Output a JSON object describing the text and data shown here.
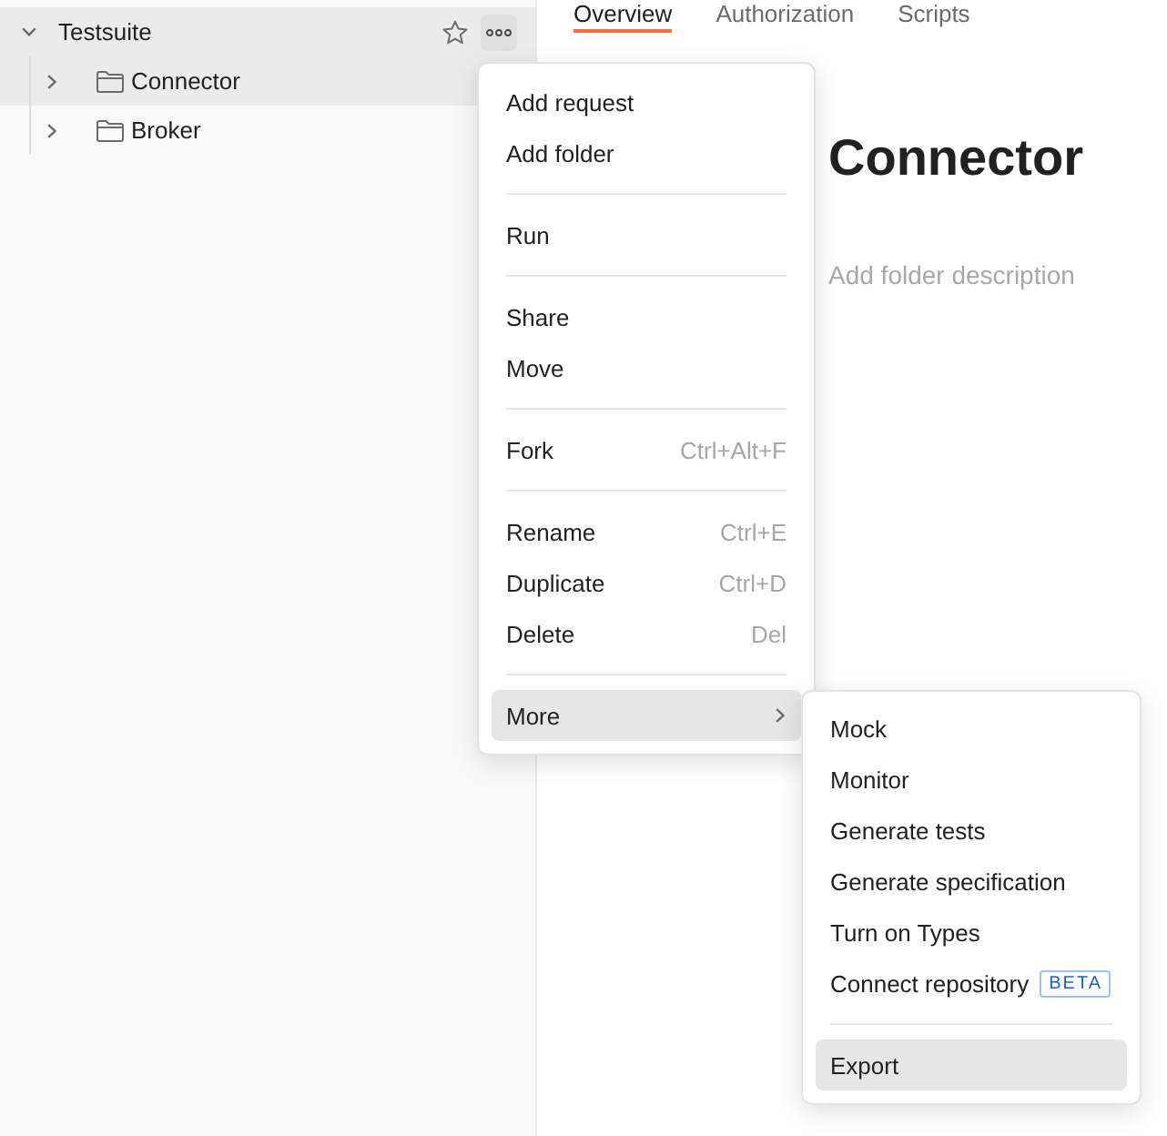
{
  "sidebar": {
    "collection": {
      "name": "Testsuite",
      "expanded": true,
      "starred": false,
      "menu_open": true,
      "children": [
        {
          "name": "Connector",
          "expanded": false,
          "selected": true
        },
        {
          "name": "Broker",
          "expanded": false,
          "selected": false
        }
      ]
    }
  },
  "tabs": [
    {
      "label": "Overview",
      "selected": true
    },
    {
      "label": "Authorization",
      "selected": false
    },
    {
      "label": "Scripts",
      "selected": false
    }
  ],
  "folder": {
    "title": "Connector",
    "description": {
      "placeholder": "Add folder description"
    }
  },
  "context_menu": {
    "groups": [
      {
        "items": [
          {
            "label": "Add request",
            "kind": "action",
            "highlighted": false
          },
          {
            "label": "Add folder",
            "kind": "action",
            "highlighted": false
          }
        ]
      },
      {
        "items": [
          {
            "label": "Run",
            "kind": "action",
            "highlighted": false
          }
        ]
      },
      {
        "items": [
          {
            "label": "Share",
            "kind": "action",
            "highlighted": false
          },
          {
            "label": "Move",
            "kind": "action",
            "highlighted": false
          }
        ]
      },
      {
        "items": [
          {
            "label": "Fork",
            "kind": "action",
            "highlighted": false,
            "shortcut": "Ctrl+Alt+F"
          }
        ]
      },
      {
        "items": [
          {
            "label": "Rename",
            "kind": "action",
            "highlighted": false,
            "shortcut": "Ctrl+E"
          },
          {
            "label": "Duplicate",
            "kind": "action",
            "highlighted": false,
            "shortcut": "Ctrl+D"
          },
          {
            "label": "Delete",
            "kind": "action",
            "highlighted": false,
            "shortcut": "Del"
          }
        ]
      },
      {
        "items": [
          {
            "label": "More",
            "kind": "submenu",
            "highlighted": true
          }
        ]
      }
    ]
  },
  "submenu": {
    "groups": [
      {
        "items": [
          {
            "label": "Mock",
            "kind": "action",
            "highlighted": false
          },
          {
            "label": "Monitor",
            "kind": "action",
            "highlighted": false
          },
          {
            "label": "Generate tests",
            "kind": "action",
            "highlighted": false
          },
          {
            "label": "Generate specification",
            "kind": "action",
            "highlighted": false
          },
          {
            "label": "Turn on Types",
            "kind": "action",
            "highlighted": false
          },
          {
            "label": "Connect repository",
            "kind": "action",
            "highlighted": false,
            "badge": "BETA"
          }
        ]
      },
      {
        "items": [
          {
            "label": "Export",
            "kind": "action",
            "highlighted": true
          }
        ]
      }
    ]
  }
}
